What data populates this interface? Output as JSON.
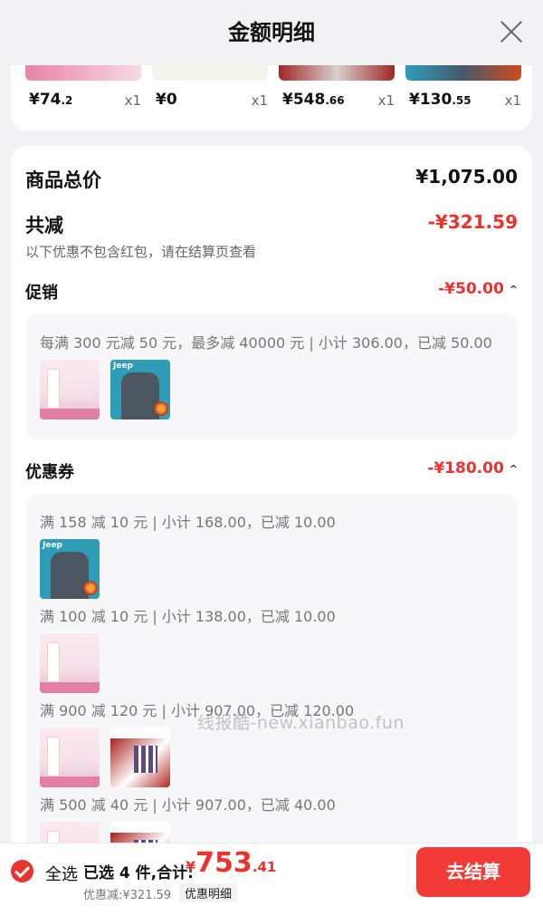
{
  "header": {
    "title": "金额明细"
  },
  "products": [
    {
      "price_int": "¥74",
      "price_dec": ".2",
      "qty": "x1"
    },
    {
      "price_int": "¥0",
      "price_dec": "",
      "qty": "x1"
    },
    {
      "price_int": "¥548",
      "price_dec": ".66",
      "qty": "x1"
    },
    {
      "price_int": "¥130",
      "price_dec": ".55",
      "qty": "x1"
    }
  ],
  "summary": {
    "total_label": "商品总价",
    "total_value": "¥1,075.00",
    "reduce_label": "共减",
    "reduce_value": "-¥321.59",
    "note": "以下优惠不包含红包，请在结算页查看"
  },
  "promo": {
    "label": "促销",
    "value": "-¥50.00",
    "rule": "每满 300 元减 50 元，最多减 40000 元 | 小计 306.00，已减 50.00"
  },
  "coupon": {
    "label": "优惠券",
    "value": "-¥180.00",
    "rules": [
      "满 158 减 10 元 | 小计 168.00，已减 10.00",
      "满 100 减 10 元 | 小计 138.00，已减 10.00",
      "满 900 减 120 元 | 小计 907.00，已减 120.00",
      "满 500 减 40 元 | 小计 907.00，已减 40.00"
    ]
  },
  "thumb_text": {
    "jeep": "Jeep"
  },
  "watermark": "线报酷-new.xianbao.fun",
  "footer": {
    "select_all": "全选",
    "selected": "已选 4 件,合计:",
    "currency": "¥",
    "total_int": "753",
    "total_dec": ".41",
    "discount": "优惠减:¥321.59",
    "detail_btn": "优惠明细",
    "checkout": "去结算"
  },
  "colors": {
    "accent": "#e8332f",
    "button": "#f23a36"
  }
}
